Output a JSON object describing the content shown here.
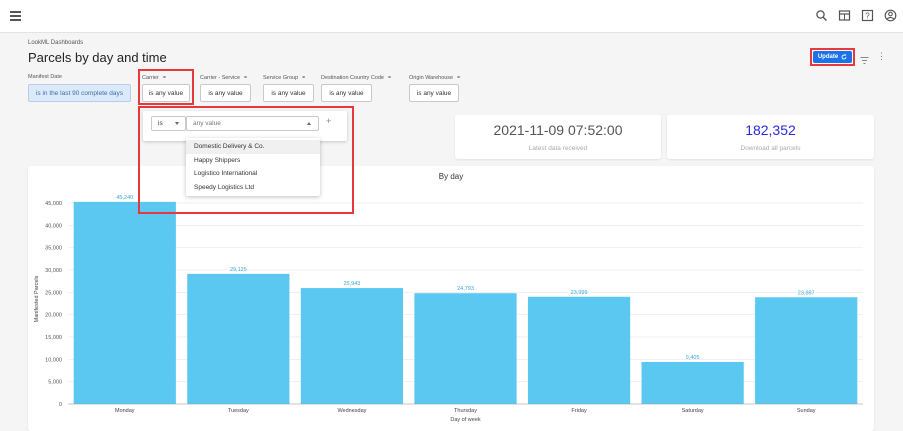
{
  "topbar": {
    "icons": [
      "search-icon",
      "grid-icon",
      "help-icon",
      "account-icon"
    ]
  },
  "header": {
    "breadcrumb": "LookML Dashboards",
    "title": "Parcels by day and time",
    "update_label": "Update"
  },
  "filters": [
    {
      "label": "Manifest Date",
      "value": "is in the last 90 complete days",
      "linked": false
    },
    {
      "label": "Carrier",
      "value": "is any value",
      "linked": true
    },
    {
      "label": "Carrier - Service",
      "value": "is any value",
      "linked": true
    },
    {
      "label": "Service Group",
      "value": "is any value",
      "linked": true
    },
    {
      "label": "Destination Country Code",
      "value": "is any value",
      "linked": true
    },
    {
      "label": "Origin Warehouse",
      "value": "is any value",
      "linked": true
    }
  ],
  "filter_popup": {
    "operator": "is",
    "placeholder": "any value",
    "add": "+",
    "options": [
      "Domestic Delivery & Co.",
      "Happy Shippers",
      "Logistico International",
      "Speedy Logistics Ltd"
    ]
  },
  "tiles": [
    {
      "value": "2021-11-09 07:52:00",
      "caption": "Latest data received"
    },
    {
      "value": "182,352",
      "caption": "Download all parcels"
    }
  ],
  "colors": {
    "bar": "#5ac8f0",
    "accent": "#1a73e8",
    "highlight": "#e8383d",
    "tile_number": "#2a2ae0"
  },
  "chart_data": {
    "type": "bar",
    "title": "By day",
    "xlabel": "Day of week",
    "ylabel": "Manifested Parcels",
    "categories": [
      "Monday",
      "Tuesday",
      "Wednesday",
      "Thursday",
      "Friday",
      "Saturday",
      "Sunday"
    ],
    "values": [
      45240,
      29125,
      25943,
      24793,
      23999,
      9405,
      23887
    ],
    "value_labels": [
      "45,240",
      "29,125",
      "25,943",
      "24,793",
      "23,999",
      "9,405",
      "23,887"
    ],
    "yticks": [
      0,
      5000,
      10000,
      15000,
      20000,
      25000,
      30000,
      35000,
      40000,
      45000
    ],
    "ytick_labels": [
      "0",
      "5,000",
      "10,000",
      "15,000",
      "20,000",
      "25,000",
      "30,000",
      "35,000",
      "40,000",
      "45,000"
    ],
    "ylim": [
      0,
      47000
    ],
    "grid": true
  }
}
